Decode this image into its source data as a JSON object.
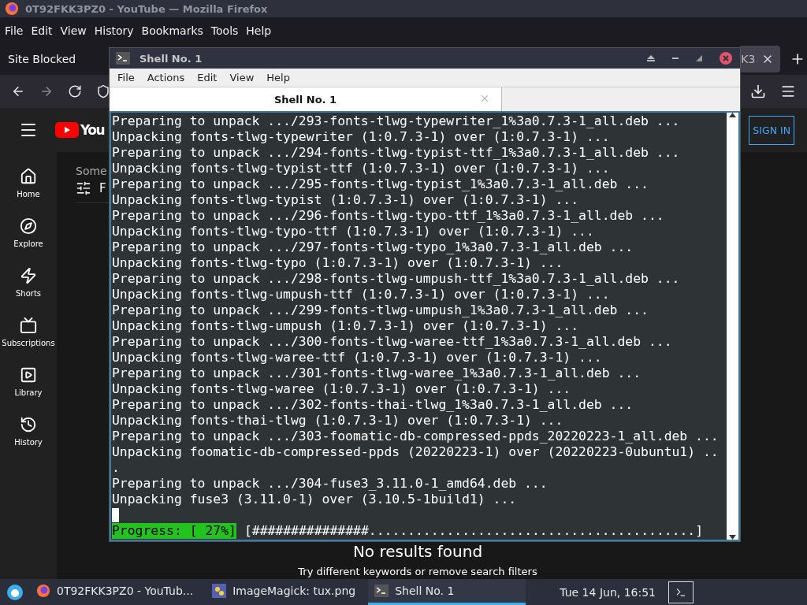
{
  "browser": {
    "title": "0T92FKK3PZ0 - YouTube — Mozilla Firefox",
    "menu": [
      "File",
      "Edit",
      "View",
      "History",
      "Bookmarks",
      "Tools",
      "Help"
    ],
    "tabs": [
      {
        "label": "Site Blocked",
        "selected": false
      },
      {
        "label": "K3",
        "selected": true
      }
    ],
    "youtube": {
      "logo_text": "You",
      "sign_in": "SIGN IN",
      "sidebar": [
        {
          "label": "Home"
        },
        {
          "label": "Explore"
        },
        {
          "label": "Shorts"
        },
        {
          "label": "Subscriptions"
        },
        {
          "label": "Library"
        },
        {
          "label": "History"
        }
      ],
      "summary": "Some",
      "filter_label": "F",
      "empty_title": "No results found",
      "empty_hint": "Try different keywords or remove search filters"
    }
  },
  "terminal": {
    "title": "Shell No. 1",
    "menu": [
      "File",
      "Actions",
      "Edit",
      "View",
      "Help"
    ],
    "tabs": [
      {
        "label": "Shell No. 1",
        "selected": true
      }
    ],
    "lines": [
      "Preparing to unpack .../293-fonts-tlwg-typewriter_1%3a0.7.3-1_all.deb ...",
      "Unpacking fonts-tlwg-typewriter (1:0.7.3-1) over (1:0.7.3-1) ...",
      "Preparing to unpack .../294-fonts-tlwg-typist-ttf_1%3a0.7.3-1_all.deb ...",
      "Unpacking fonts-tlwg-typist-ttf (1:0.7.3-1) over (1:0.7.3-1) ...",
      "Preparing to unpack .../295-fonts-tlwg-typist_1%3a0.7.3-1_all.deb ...",
      "Unpacking fonts-tlwg-typist (1:0.7.3-1) over (1:0.7.3-1) ...",
      "Preparing to unpack .../296-fonts-tlwg-typo-ttf_1%3a0.7.3-1_all.deb ...",
      "Unpacking fonts-tlwg-typo-ttf (1:0.7.3-1) over (1:0.7.3-1) ...",
      "Preparing to unpack .../297-fonts-tlwg-typo_1%3a0.7.3-1_all.deb ...",
      "Unpacking fonts-tlwg-typo (1:0.7.3-1) over (1:0.7.3-1) ...",
      "Preparing to unpack .../298-fonts-tlwg-umpush-ttf_1%3a0.7.3-1_all.deb ...",
      "Unpacking fonts-tlwg-umpush-ttf (1:0.7.3-1) over (1:0.7.3-1) ...",
      "Preparing to unpack .../299-fonts-tlwg-umpush_1%3a0.7.3-1_all.deb ...",
      "Unpacking fonts-tlwg-umpush (1:0.7.3-1) over (1:0.7.3-1) ...",
      "Preparing to unpack .../300-fonts-tlwg-waree-ttf_1%3a0.7.3-1_all.deb ...",
      "Unpacking fonts-tlwg-waree-ttf (1:0.7.3-1) over (1:0.7.3-1) ...",
      "Preparing to unpack .../301-fonts-tlwg-waree_1%3a0.7.3-1_all.deb ...",
      "Unpacking fonts-tlwg-waree (1:0.7.3-1) over (1:0.7.3-1) ...",
      "Preparing to unpack .../302-fonts-thai-tlwg_1%3a0.7.3-1_all.deb ...",
      "Unpacking fonts-thai-tlwg (1:0.7.3-1) over (1:0.7.3-1) ...",
      "Preparing to unpack .../303-foomatic-db-compressed-ppds_20220223-1_all.deb ...",
      "Unpacking foomatic-db-compressed-ppds (20220223-1) over (20220223-0ubuntu1) ..",
      ".",
      "Preparing to unpack .../304-fuse3_3.11.0-1_amd64.deb ...",
      "Unpacking fuse3 (3.11.0-1) over (3.10.5-1build1) ..."
    ],
    "progress": {
      "label": "Progress: [ 27%]",
      "bar": "[###############..........................................]"
    }
  },
  "taskbar": {
    "items": [
      {
        "label": "0T92FKK3PZ0 - YouTub...",
        "kind": "browser",
        "selected": false
      },
      {
        "label": "ImageMagick: tux.png",
        "kind": "image",
        "selected": false
      },
      {
        "label": "Shell No. 1",
        "kind": "terminal",
        "selected": true
      }
    ],
    "clock": "Tue 14 Jun, 16:51"
  }
}
